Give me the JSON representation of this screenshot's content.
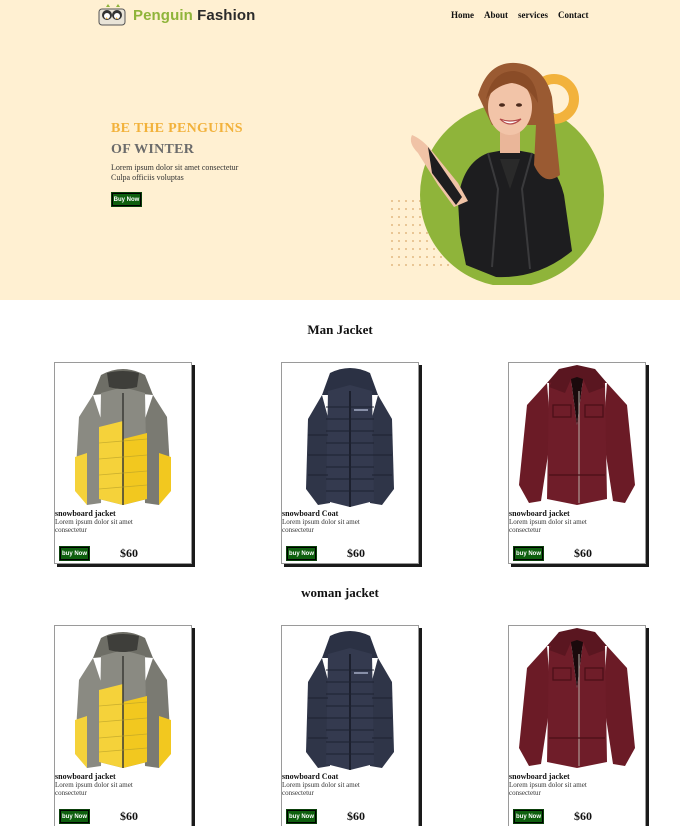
{
  "brand": {
    "name_first": "Penguin",
    "name_second": "Fashion",
    "color_green": "#8fb43a",
    "logo_icon": "penguin-logo-icon"
  },
  "nav": {
    "home": "Home",
    "about": "About",
    "services": "services",
    "contact": "Contact"
  },
  "hero": {
    "title_line1": "BE THE PENGUINS",
    "title_line2": "OF WINTER",
    "text_line1": "Lorem ipsum dolor sit amet consectetur",
    "text_line2": "Culpa officiis voluptas",
    "button": "Buy Now",
    "accent_yellow": "#f2b23c",
    "accent_green": "#8fb43a"
  },
  "sections": {
    "man": {
      "title": "Man Jacket",
      "products": [
        {
          "name": "snowboard jacket",
          "desc": "Lorem ipsum dolor sit amet consectetur",
          "button": "buy Now",
          "price": "$60",
          "image": "yellow-gray-puffer-jacket"
        },
        {
          "name": "snowboard Coat",
          "desc": "Lorem ipsum dolor sit amet consectetur",
          "button": "buy Now",
          "price": "$60",
          "image": "navy-puffer-jacket"
        },
        {
          "name": "snowboard jacket",
          "desc": "Lorem ipsum dolor sit amet consectetur",
          "button": "buy Now",
          "price": "$60",
          "image": "burgundy-leather-jacket"
        }
      ]
    },
    "woman": {
      "title": "woman jacket",
      "products": [
        {
          "name": "snowboard jacket",
          "desc": "Lorem ipsum dolor sit amet consectetur",
          "button": "buy Now",
          "price": "$60",
          "image": "yellow-gray-puffer-jacket"
        },
        {
          "name": "snowboard Coat",
          "desc": "Lorem ipsum dolor sit amet consectetur",
          "button": "buy Now",
          "price": "$60",
          "image": "navy-puffer-jacket"
        },
        {
          "name": "snowboard jacket",
          "desc": "Lorem ipsum dolor sit amet consectetur",
          "button": "buy Now",
          "price": "$60",
          "image": "burgundy-leather-jacket"
        }
      ]
    }
  },
  "colors": {
    "hero_bg": "#fff0d2",
    "button_green": "#0e5f0e"
  }
}
